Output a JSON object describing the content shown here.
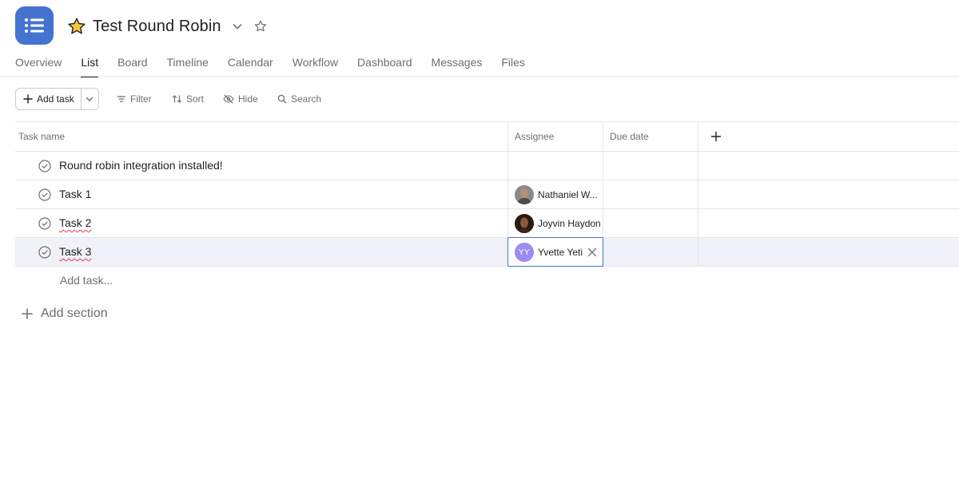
{
  "project": {
    "title": "Test Round Robin",
    "icon": "list-icon",
    "color": "#4573d2"
  },
  "tabs": [
    {
      "label": "Overview",
      "active": false
    },
    {
      "label": "List",
      "active": true
    },
    {
      "label": "Board",
      "active": false
    },
    {
      "label": "Timeline",
      "active": false
    },
    {
      "label": "Calendar",
      "active": false
    },
    {
      "label": "Workflow",
      "active": false
    },
    {
      "label": "Dashboard",
      "active": false
    },
    {
      "label": "Messages",
      "active": false
    },
    {
      "label": "Files",
      "active": false
    }
  ],
  "toolbar": {
    "add_task_label": "Add task",
    "filter_label": "Filter",
    "sort_label": "Sort",
    "hide_label": "Hide",
    "search_label": "Search"
  },
  "table": {
    "columns": [
      "Task name",
      "Assignee",
      "Due date"
    ],
    "rows": [
      {
        "name": "Round robin integration installed!",
        "assignee": "",
        "due": ""
      },
      {
        "name": "Task 1",
        "assignee": "Nathaniel W...",
        "due": ""
      },
      {
        "name": "Task 2",
        "assignee": "Joyvin Haydon",
        "due": ""
      },
      {
        "name": "Task 3",
        "assignee": "Yvette Yeti",
        "assignee_initials": "YY",
        "due": ""
      }
    ],
    "add_task_placeholder": "Add task...",
    "add_section_label": "Add section"
  }
}
